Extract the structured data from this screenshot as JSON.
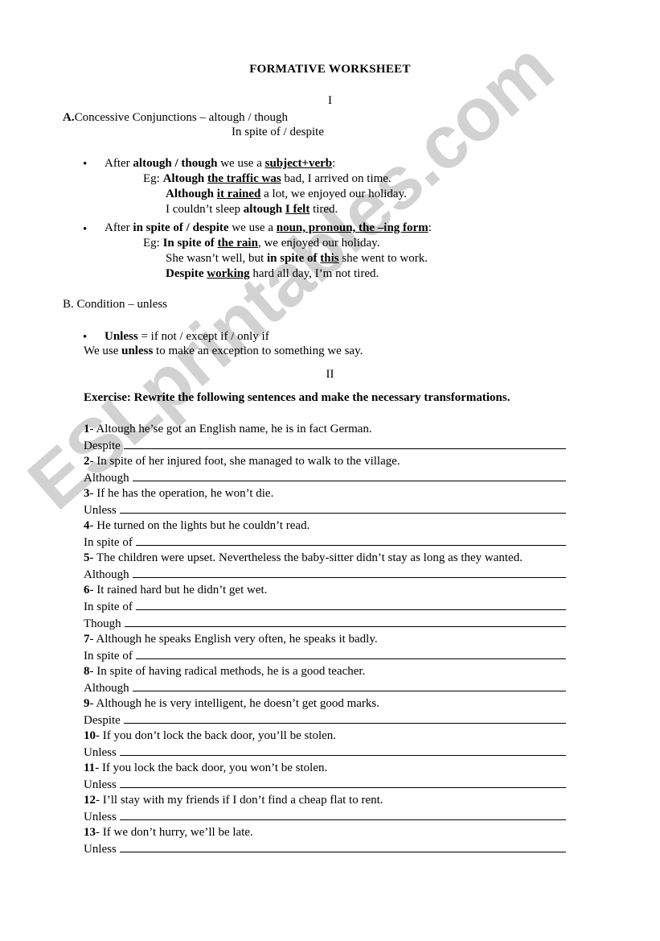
{
  "document": {
    "title": "FORMATIVE WORKSHEET",
    "watermark": "ESLprintables.com",
    "roman_one": "I",
    "roman_two": "II"
  },
  "section_a": {
    "heading_label": "A.",
    "heading_text": "Concessive Conjunctions – altough / though",
    "subheading": "In spite of / despite",
    "bullet1": {
      "pre": "After ",
      "bold1": "altough / though",
      "mid": " we use a ",
      "underline_bold": "subject+verb",
      "post": ":"
    },
    "bullet1_examples": [
      {
        "label": "Eg:",
        "bold": "Altough",
        "underline_bold": "the traffic was",
        "rest": " bad, I arrived on time."
      },
      {
        "label": "",
        "bold": "Although",
        "underline_bold": "it rained",
        "rest": " a lot, we enjoyed our holiday."
      },
      {
        "label": "",
        "pre": "I couldn’t sleep ",
        "bold": "altough",
        "underline_bold": "I felt",
        "rest": " tired."
      }
    ],
    "bullet2": {
      "pre": "After ",
      "bold1": "in spite of / despite",
      "mid": " we use a ",
      "underline_bold": "noun, pronoun, the –ing form",
      "post": ":"
    },
    "bullet2_examples": [
      {
        "label": "Eg:",
        "bold": "In spite of",
        "underline_bold": "the rain",
        "rest": ", we enjoyed our holiday."
      },
      {
        "label": "",
        "pre": "She wasn’t well, but ",
        "bold": "in spite of",
        "underline_bold": "this",
        "rest": " she went to work."
      },
      {
        "label": "",
        "bold": "Despite",
        "underline_bold": "working",
        "rest": " hard all day, I’m not tired."
      }
    ]
  },
  "section_b": {
    "heading_label": "B.",
    "heading_text": "Condition – unless",
    "bullet": {
      "bold": "Unless",
      "rest": " = if not / except if / only if"
    },
    "note": {
      "pre": "We use ",
      "bold": "unless",
      "post": " to make an exception to something we say."
    }
  },
  "exercise": {
    "heading": "Exercise: Rewrite the following sentences and make the necessary transformations.",
    "items": [
      {
        "num": "1",
        "sep": "- ",
        "question": "Altough he’se got an English name, he is in fact German.",
        "prompt": "Despite",
        "rule_width": "full"
      },
      {
        "num": "2",
        "sep": "- ",
        "question": "In spite of her injured foot, she managed to walk to the village.",
        "prompt": "Although",
        "rule_width": "full"
      },
      {
        "num": "3",
        "sep": "- ",
        "question": "If he has the operation, he won’t die.",
        "prompt": "Unless",
        "rule_width": "full"
      },
      {
        "num": "4",
        "sep": "- ",
        "question": "He turned on the lights but he couldn’t read.",
        "prompt": "In spite of",
        "rule_width": "full"
      },
      {
        "num": "5",
        "sep": "- ",
        "question": "The children were upset. Nevertheless the baby-sitter didn’t stay as long as they wanted.",
        "prompt": "Although",
        "rule_width": "full"
      },
      {
        "num": "6",
        "sep": "- ",
        "question": "It rained hard but he didn’t get wet.",
        "prompt": "In spite of",
        "prompt2": "Though",
        "rule_width": "full"
      },
      {
        "num": "7",
        "sep": "- ",
        "question": "Although he speaks English very often, he speaks it badly.",
        "prompt": "In spite of",
        "rule_width": "full"
      },
      {
        "num": "8",
        "sep": "- ",
        "question": "In spite of having radical methods, he is a good teacher.",
        "prompt": "Although",
        "rule_width": "full"
      },
      {
        "num": "9",
        "sep": "- ",
        "question": "Although he is very intelligent, he doesn’t get good marks.",
        "prompt": "Despite",
        "rule_width": "full"
      },
      {
        "num": "10",
        "sep": "- ",
        "question": "If you don’t lock the back door, you’ll be stolen.",
        "prompt": "Unless",
        "rule_width": "full"
      },
      {
        "num": "11",
        "sep": "- ",
        "question": "If you lock the back door, you won’t be stolen.",
        "prompt": "Unless",
        "rule_width": "full"
      },
      {
        "num": "12",
        "sep": "- ",
        "question": "I’ll stay with my friends if I don’t find a cheap flat to rent.",
        "prompt": "Unless",
        "rule_width": "full"
      },
      {
        "num": "13",
        "sep": "- ",
        "question": "If we don’t hurry, we’ll be late.",
        "prompt": "Unless",
        "rule_width": "full"
      }
    ]
  }
}
